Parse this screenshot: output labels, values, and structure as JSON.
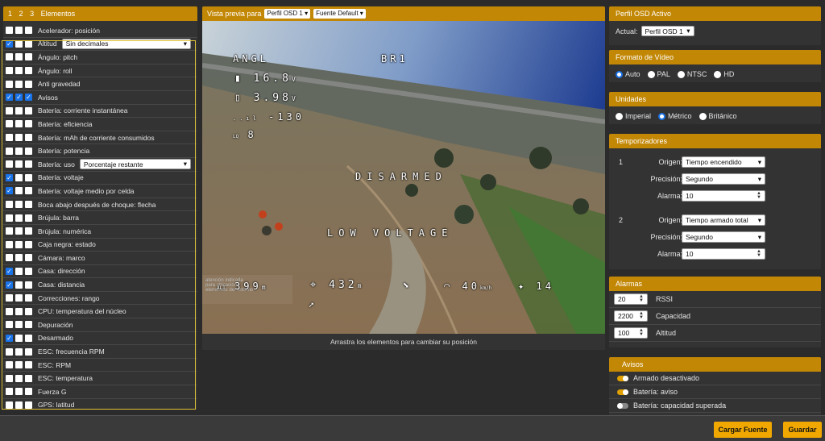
{
  "left": {
    "tabs": [
      "1",
      "2",
      "3"
    ],
    "title": "Elementos",
    "items": [
      {
        "label": "Acelerador: posición",
        "c": [
          0,
          0,
          0
        ]
      },
      {
        "label": "Altitud",
        "c": [
          1,
          0,
          0
        ],
        "select": "Sin decimales"
      },
      {
        "label": "Ángulo: pitch",
        "c": [
          0,
          0,
          0
        ]
      },
      {
        "label": "Ángulo: roll",
        "c": [
          0,
          0,
          0
        ]
      },
      {
        "label": "Anti gravedad",
        "c": [
          0,
          0,
          0
        ]
      },
      {
        "label": "Avisos",
        "c": [
          1,
          1,
          1
        ]
      },
      {
        "label": "Batería: corriente instantánea",
        "c": [
          0,
          0,
          0
        ]
      },
      {
        "label": "Batería: eficiencia",
        "c": [
          0,
          0,
          0
        ]
      },
      {
        "label": "Batería: mAh de corriente consumidos",
        "c": [
          0,
          0,
          0
        ]
      },
      {
        "label": "Batería: potencia",
        "c": [
          0,
          0,
          0
        ]
      },
      {
        "label": "Batería: uso",
        "c": [
          0,
          0,
          0
        ],
        "select": "Porcentaje restante"
      },
      {
        "label": "Batería: voltaje",
        "c": [
          1,
          0,
          0
        ]
      },
      {
        "label": "Batería: voltaje medio por celda",
        "c": [
          1,
          0,
          0
        ]
      },
      {
        "label": "Boca abajo después de choque: flecha",
        "c": [
          0,
          0,
          0
        ]
      },
      {
        "label": "Brújula: barra",
        "c": [
          0,
          0,
          0
        ]
      },
      {
        "label": "Brújula: numérica",
        "c": [
          0,
          0,
          0
        ]
      },
      {
        "label": "Caja negra: estado",
        "c": [
          0,
          0,
          0
        ]
      },
      {
        "label": "Cámara: marco",
        "c": [
          0,
          0,
          0
        ]
      },
      {
        "label": "Casa: dirección",
        "c": [
          1,
          0,
          0
        ]
      },
      {
        "label": "Casa: distancia",
        "c": [
          1,
          0,
          0
        ]
      },
      {
        "label": "Correcciones: rango",
        "c": [
          0,
          0,
          0
        ]
      },
      {
        "label": "CPU: temperatura del núcleo",
        "c": [
          0,
          0,
          0
        ]
      },
      {
        "label": "Depuración",
        "c": [
          0,
          0,
          0
        ]
      },
      {
        "label": "Desarmado",
        "c": [
          1,
          0,
          0
        ]
      },
      {
        "label": "ESC: frecuencia RPM",
        "c": [
          0,
          0,
          0
        ]
      },
      {
        "label": "ESC: RPM",
        "c": [
          0,
          0,
          0
        ]
      },
      {
        "label": "ESC: temperatura",
        "c": [
          0,
          0,
          0
        ]
      },
      {
        "label": "Fuerza G",
        "c": [
          0,
          0,
          0
        ]
      },
      {
        "label": "GPS: latitud",
        "c": [
          0,
          0,
          0
        ]
      }
    ]
  },
  "preview": {
    "title": "Vista previa para",
    "profile": "Perfil OSD 1",
    "font": "Fuente Default",
    "footer": "Arrastra los elementos para cambiar su posición",
    "osd": {
      "angl": "ANGL",
      "br": "BR1",
      "voltage": "16.8",
      "cell": "3.98",
      "rssi": "-130",
      "lq": "8",
      "disarmed": "DISARMED",
      "low_voltage": "LOW VOLTAGE",
      "alt": "399",
      "alt_unit": "m",
      "dist": "432",
      "dist_unit": "m",
      "speed": "40",
      "sats": "14",
      "ghost_text": "atención indicada\npara ubicación\nelementos del entorno"
    }
  },
  "osd_profile": {
    "title": "Perfil OSD Activo",
    "label": "Actual:",
    "value": "Perfil OSD 1"
  },
  "video_format": {
    "title": "Formato de Vídeo",
    "options": [
      "Auto",
      "PAL",
      "NTSC",
      "HD"
    ],
    "selected": "Auto"
  },
  "units": {
    "title": "Unidades",
    "options": [
      "Imperial",
      "Métrico",
      "Británico"
    ],
    "selected": "Métrico"
  },
  "timers": {
    "title": "Temporizadores",
    "labels": {
      "source": "Origen:",
      "precision": "Precisión:",
      "alarm": "Alarma:"
    },
    "items": [
      {
        "num": "1",
        "source": "Tiempo encendido",
        "precision": "Segundo",
        "alarm": "10"
      },
      {
        "num": "2",
        "source": "Tiempo armado total",
        "precision": "Segundo",
        "alarm": "10"
      }
    ]
  },
  "alarms": {
    "title": "Alarmas",
    "items": [
      {
        "value": "20",
        "label": "RSSI"
      },
      {
        "value": "2200",
        "label": "Capacidad"
      },
      {
        "value": "100",
        "label": "Altitud"
      }
    ]
  },
  "warnings": {
    "title": "Avisos",
    "items": [
      {
        "label": "Armado desactivado",
        "on": true
      },
      {
        "label": "Batería: aviso",
        "on": true
      },
      {
        "label": "Batería: capacidad superada",
        "on": false
      }
    ]
  },
  "buttons": {
    "load_font": "Cargar Fuente",
    "save": "Guardar"
  },
  "colors": {
    "accent": "#c28705",
    "button": "#f0a800",
    "checkbox_on": "#1a73e8",
    "highlight": "#e0c23a"
  }
}
